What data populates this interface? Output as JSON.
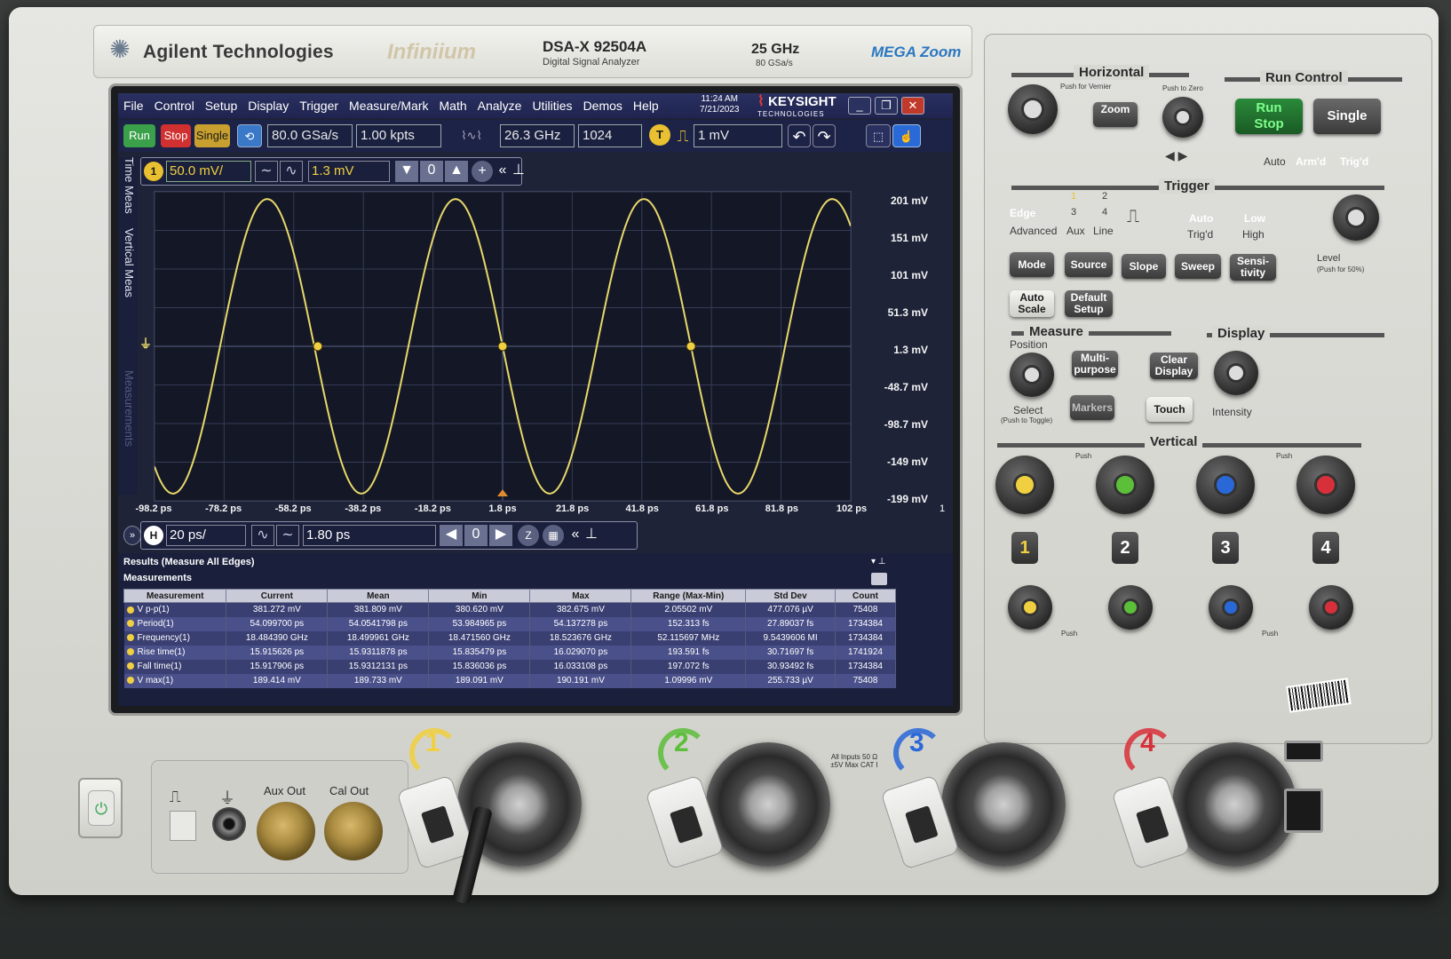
{
  "front_panel": {
    "brand": "Agilent Technologies",
    "series": "Infiniium",
    "model": "DSA-X 92504A",
    "model_desc": "Digital Signal Analyzer",
    "bandwidth": "25 GHz",
    "sample_rate": "80 GSa/s",
    "megazoom": "MEGA Zoom"
  },
  "menu": {
    "items": [
      "File",
      "Control",
      "Setup",
      "Display",
      "Trigger",
      "Measure/Mark",
      "Math",
      "Analyze",
      "Utilities",
      "Demos",
      "Help"
    ],
    "time": "11:24 AM",
    "date": "7/21/2023",
    "keysight": "KEYSIGHT",
    "keysight_sub": "TECHNOLOGIES"
  },
  "toolbar": {
    "run": "Run",
    "stop": "Stop",
    "single": "Single",
    "sample_rate": "80.0 GSa/s",
    "memory_depth": "1.00 kpts",
    "bandwidth": "26.3 GHz",
    "averages": "1024",
    "trigger_level": "1 mV",
    "trigger_icon": "T"
  },
  "channel": {
    "number": "1",
    "scale": "50.0 mV/",
    "offset": "1.3 mV"
  },
  "sidetabs": {
    "time_meas": "Time Meas",
    "vertical_meas": "Vertical Meas",
    "measurements": "Measurements"
  },
  "horizontal": {
    "label": "H",
    "scale": "20 ps/",
    "position": "1.80 ps"
  },
  "y_axis_labels": [
    "201 mV",
    "151 mV",
    "101 mV",
    "51.3 mV",
    "1.3 mV",
    "-48.7 mV",
    "-98.7 mV",
    "-149 mV",
    "-199 mV"
  ],
  "x_axis_labels": [
    "-98.2 ps",
    "-78.2 ps",
    "-58.2 ps",
    "-38.2 ps",
    "-18.2 ps",
    "1.8 ps",
    "21.8 ps",
    "41.8 ps",
    "61.8 ps",
    "81.8 ps",
    "102 ps"
  ],
  "x_axis_page": "1",
  "results": {
    "title": "Results   (Measure All Edges)",
    "subtitle": "Measurements",
    "headers": [
      "Measurement",
      "Current",
      "Mean",
      "Min",
      "Max",
      "Range (Max-Min)",
      "Std Dev",
      "Count"
    ],
    "rows": [
      [
        "V p-p(1)",
        "381.272 mV",
        "381.809 mV",
        "380.620 mV",
        "382.675 mV",
        "2.05502 mV",
        "477.076 µV",
        "75408"
      ],
      [
        "Period(1)",
        "54.099700 ps",
        "54.0541798 ps",
        "53.984965 ps",
        "54.137278 ps",
        "152.313 fs",
        "27.89037 fs",
        "1734384"
      ],
      [
        "Frequency(1)",
        "18.484390 GHz",
        "18.499961 GHz",
        "18.471560 GHz",
        "18.523676 GHz",
        "52.115697 MHz",
        "9.5439606 MI",
        "1734384"
      ],
      [
        "Rise time(1)",
        "15.915626 ps",
        "15.9311878 ps",
        "15.835479 ps",
        "16.029070 ps",
        "193.591 fs",
        "30.71697 fs",
        "1741924"
      ],
      [
        "Fall time(1)",
        "15.917906 ps",
        "15.9312131 ps",
        "15.836036 ps",
        "16.033108 ps",
        "197.072 fs",
        "30.93492 fs",
        "1734384"
      ],
      [
        "V max(1)",
        "189.414 mV",
        "189.733 mV",
        "189.091 mV",
        "190.191 mV",
        "1.09996 mV",
        "255.733 µV",
        "75408"
      ]
    ]
  },
  "panel": {
    "horizontal": "Horizontal",
    "run_control": "Run Control",
    "zoom": "Zoom",
    "run_stop_1": "Run",
    "run_stop_2": "Stop",
    "single": "Single",
    "push_vernier": "Push for Vernier",
    "push_zero": "Push to Zero",
    "auto": "Auto",
    "armd": "Arm'd",
    "trigd": "Trig'd",
    "trigger": "Trigger",
    "edge": "Edge",
    "advanced": "Advanced",
    "aux": "Aux",
    "line": "Line",
    "src1": "1",
    "src2": "2",
    "src3": "3",
    "src4": "4",
    "trig_auto": "Auto",
    "trig_trigd": "Trig'd",
    "low": "Low",
    "high": "High",
    "level": "Level",
    "level_sub": "(Push for 50%)",
    "mode": "Mode",
    "source": "Source",
    "slope": "Slope",
    "sweep": "Sweep",
    "sensitivity_1": "Sensi-",
    "sensitivity_2": "tivity",
    "auto_scale_1": "Auto",
    "auto_scale_2": "Scale",
    "default_setup_1": "Default",
    "default_setup_2": "Setup",
    "measure": "Measure",
    "display": "Display",
    "position": "Position",
    "multi_1": "Multi-",
    "multi_2": "purpose",
    "clear_display_1": "Clear",
    "clear_display_2": "Display",
    "select": "Select",
    "select_sub": "(Push to Toggle)",
    "markers": "Markers",
    "touch": "Touch",
    "intensity": "Intensity",
    "vertical": "Vertical",
    "ch1": "1",
    "ch2": "2",
    "ch3": "3",
    "ch4": "4",
    "push_vernier_short": "Push",
    "push_zero_short": "Push"
  },
  "bottom": {
    "aux_out": "Aux Out",
    "cal_out": "Cal Out",
    "all_inputs": "All Inputs 50 Ω ±5V Max CAT I",
    "ch1": "1",
    "ch2": "2",
    "ch3": "3",
    "ch4": "4"
  },
  "colors": {
    "ch1": "#f0d040",
    "ch2": "#5cbf3a",
    "ch3": "#2a68d8",
    "ch4": "#d8303a",
    "trace": "#e8d86a"
  },
  "waveform": {
    "frequency_ghz": 18.48,
    "amplitude_mv": 190.6,
    "offset_mv": 1.3
  }
}
